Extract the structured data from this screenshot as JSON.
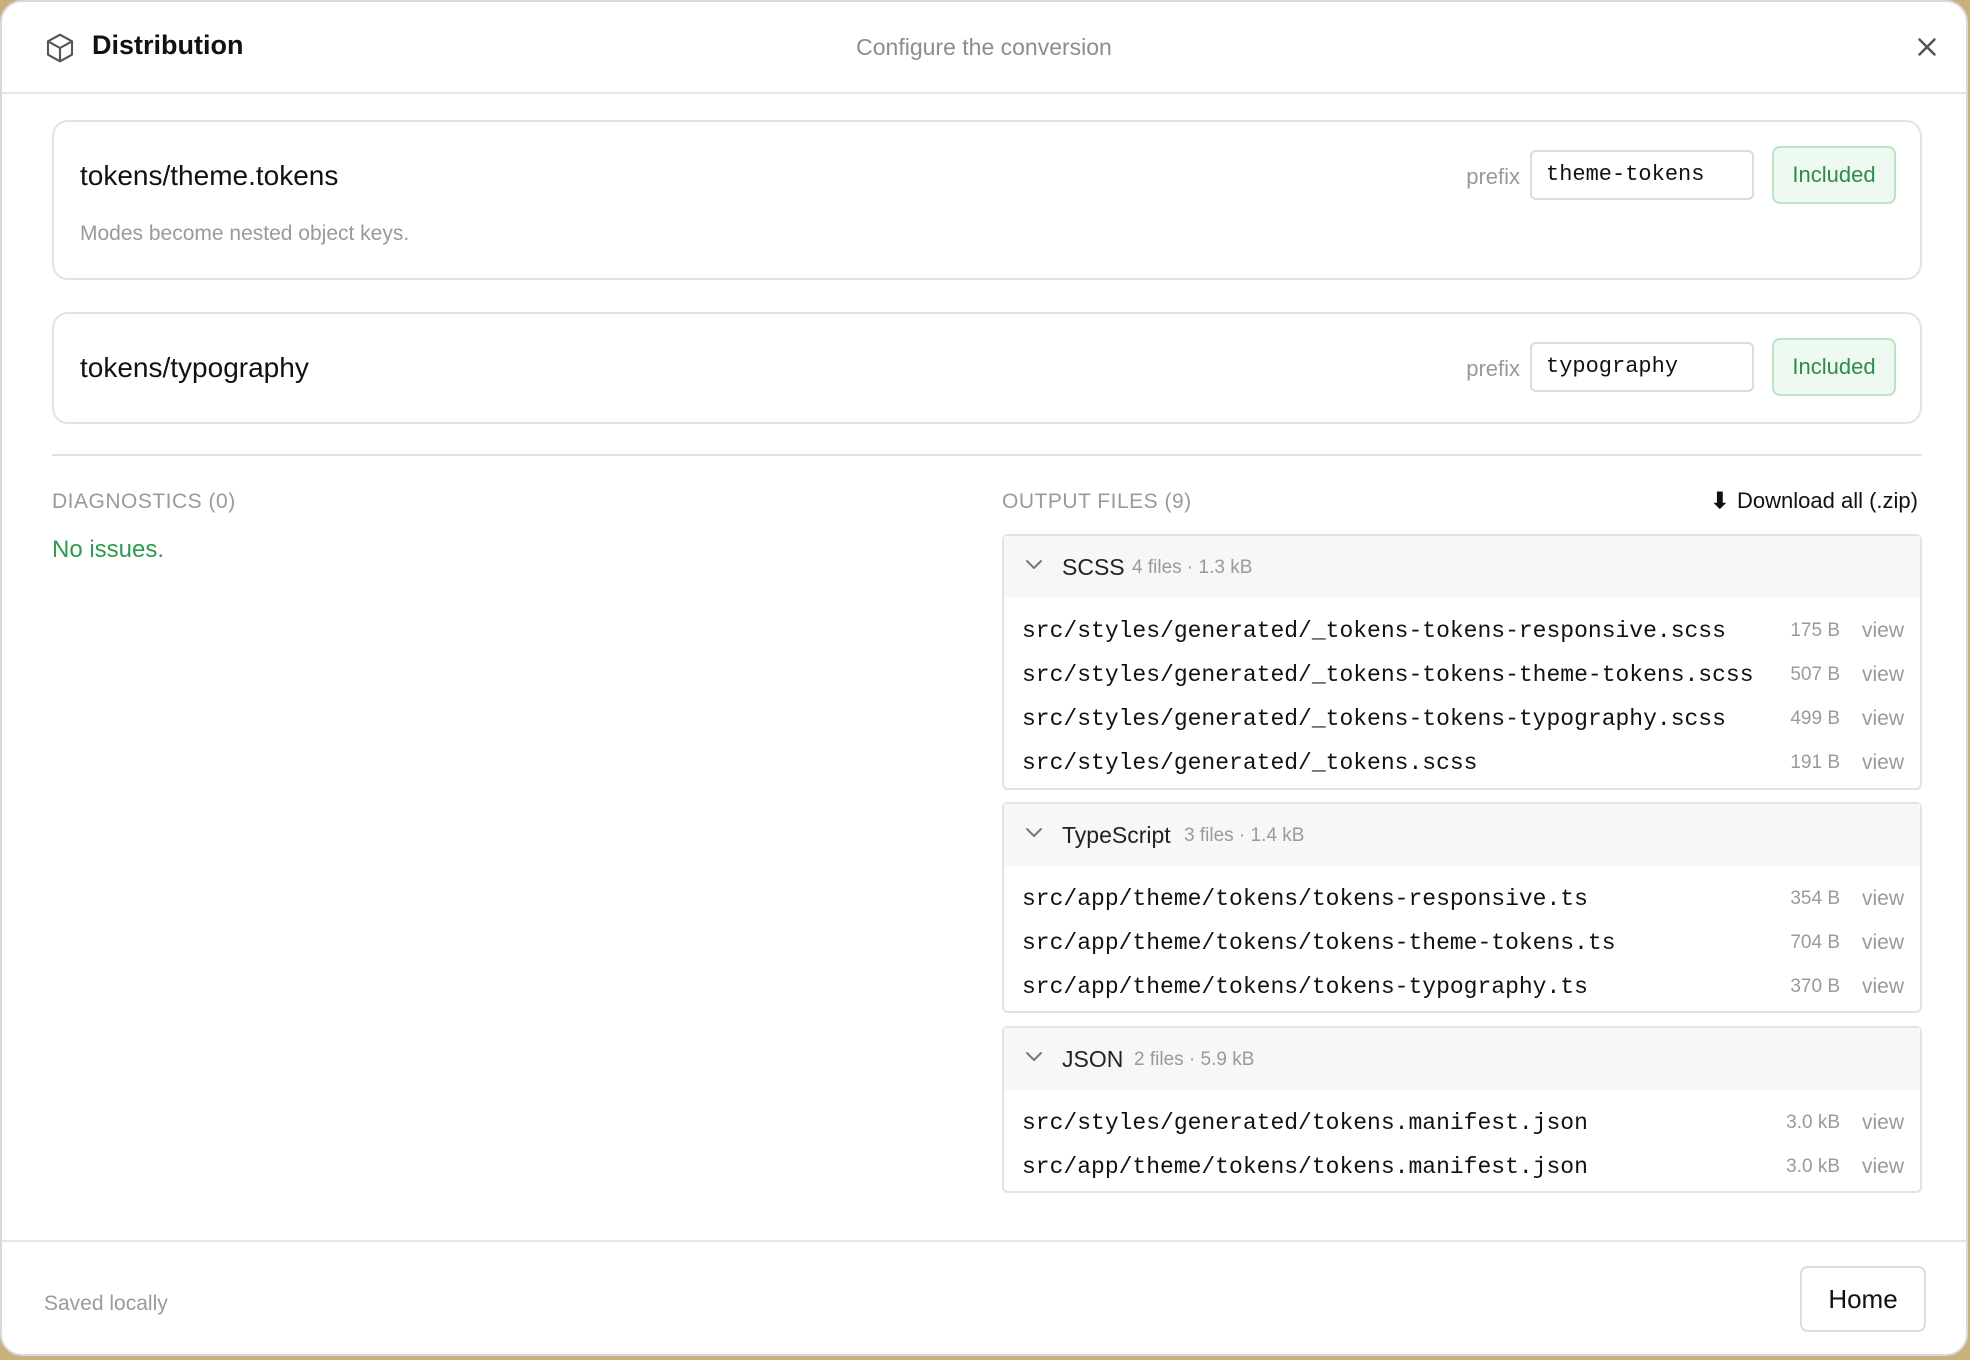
{
  "header": {
    "title": "Distribution",
    "subtitle": "Configure the conversion",
    "icon": "cube-icon",
    "close_icon": "close-icon"
  },
  "tokens": [
    {
      "name": "tokens/theme.tokens",
      "description": "Modes become nested object keys.",
      "prefix_label": "prefix",
      "prefix_value": "theme-tokens",
      "status": "Included"
    },
    {
      "name": "tokens/typography",
      "description": "",
      "prefix_label": "prefix",
      "prefix_value": "typography",
      "status": "Included"
    }
  ],
  "diagnostics": {
    "label": "DIAGNOSTICS (0)",
    "message": "No issues."
  },
  "output": {
    "label": "OUTPUT FILES (9)",
    "download_label": "Download all (.zip)",
    "groups": [
      {
        "name": "SCSS",
        "meta": "4 files · 1.3 kB",
        "files": [
          {
            "path": "src/styles/generated/_tokens-tokens-responsive.scss",
            "size": "175 B",
            "action": "view"
          },
          {
            "path": "src/styles/generated/_tokens-tokens-theme-tokens.scss",
            "size": "507 B",
            "action": "view"
          },
          {
            "path": "src/styles/generated/_tokens-tokens-typography.scss",
            "size": "499 B",
            "action": "view"
          },
          {
            "path": "src/styles/generated/_tokens.scss",
            "size": "191 B",
            "action": "view"
          }
        ]
      },
      {
        "name": "TypeScript",
        "meta": "3 files · 1.4 kB",
        "files": [
          {
            "path": "src/app/theme/tokens/tokens-responsive.ts",
            "size": "354 B",
            "action": "view"
          },
          {
            "path": "src/app/theme/tokens/tokens-theme-tokens.ts",
            "size": "704 B",
            "action": "view"
          },
          {
            "path": "src/app/theme/tokens/tokens-typography.ts",
            "size": "370 B",
            "action": "view"
          }
        ]
      },
      {
        "name": "JSON",
        "meta": "2 files · 5.9 kB",
        "files": [
          {
            "path": "src/styles/generated/tokens.manifest.json",
            "size": "3.0 kB",
            "action": "view"
          },
          {
            "path": "src/app/theme/tokens/tokens.manifest.json",
            "size": "3.0 kB",
            "action": "view"
          }
        ]
      }
    ]
  },
  "footer": {
    "status": "Saved locally",
    "home_label": "Home"
  },
  "colors": {
    "accent_green": "#2e9a4f",
    "badge_bg": "#eefaf1",
    "badge_border": "#b9e5c6"
  }
}
